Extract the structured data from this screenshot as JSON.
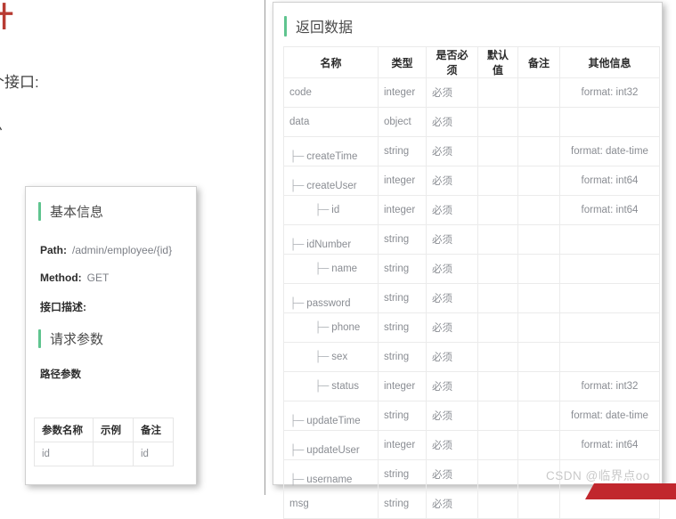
{
  "document_fragments": {
    "heading": "计",
    "line1": "个接口:",
    "line2": "息"
  },
  "basic_info_card": {
    "title": "基本信息",
    "fields": [
      {
        "key": "Path:",
        "value": "/admin/employee/{id}"
      },
      {
        "key": "Method:",
        "value": "GET"
      },
      {
        "key": "接口描述:",
        "value": ""
      }
    ],
    "params_title": "请求参数",
    "path_param_label": "路径参数",
    "param_table": {
      "headers": [
        "参数名称",
        "示例",
        "备注"
      ],
      "rows": [
        {
          "name": "id",
          "demo": "",
          "note": "id"
        }
      ]
    }
  },
  "return_data_card": {
    "title": "返回数据",
    "table": {
      "headers": [
        "名称",
        "类型",
        "是否必须",
        "默认值",
        "备注",
        "其他信息"
      ],
      "rows": [
        {
          "name": "code",
          "indent": 0,
          "type": "integer",
          "required": "必须",
          "default": "",
          "remark": "",
          "extra": "format: int32"
        },
        {
          "name": "data",
          "indent": 0,
          "type": "object",
          "required": "必须",
          "default": "",
          "remark": "",
          "extra": ""
        },
        {
          "name": "createTime",
          "indent": 1,
          "type": "string",
          "required": "必须",
          "default": "",
          "remark": "",
          "extra": "format: date-time"
        },
        {
          "name": "createUser",
          "indent": 1,
          "type": "integer",
          "required": "必须",
          "default": "",
          "remark": "",
          "extra": "format: int64"
        },
        {
          "name": "id",
          "indent": 1,
          "type": "integer",
          "required": "必须",
          "default": "",
          "remark": "",
          "extra": "format: int64"
        },
        {
          "name": "idNumber",
          "indent": 1,
          "type": "string",
          "required": "必须",
          "default": "",
          "remark": "",
          "extra": ""
        },
        {
          "name": "name",
          "indent": 1,
          "type": "string",
          "required": "必须",
          "default": "",
          "remark": "",
          "extra": ""
        },
        {
          "name": "password",
          "indent": 1,
          "type": "string",
          "required": "必须",
          "default": "",
          "remark": "",
          "extra": ""
        },
        {
          "name": "phone",
          "indent": 1,
          "type": "string",
          "required": "必须",
          "default": "",
          "remark": "",
          "extra": ""
        },
        {
          "name": "sex",
          "indent": 1,
          "type": "string",
          "required": "必须",
          "default": "",
          "remark": "",
          "extra": ""
        },
        {
          "name": "status",
          "indent": 1,
          "type": "integer",
          "required": "必须",
          "default": "",
          "remark": "",
          "extra": "format: int32"
        },
        {
          "name": "updateTime",
          "indent": 1,
          "type": "string",
          "required": "必须",
          "default": "",
          "remark": "",
          "extra": "format: date-time"
        },
        {
          "name": "updateUser",
          "indent": 1,
          "type": "integer",
          "required": "必须",
          "default": "",
          "remark": "",
          "extra": "format: int64"
        },
        {
          "name": "username",
          "indent": 1,
          "type": "string",
          "required": "必须",
          "default": "",
          "remark": "",
          "extra": ""
        },
        {
          "name": "msg",
          "indent": 0,
          "type": "string",
          "required": "必须",
          "default": "",
          "remark": "",
          "extra": ""
        }
      ]
    }
  },
  "watermark": "CSDN @临界点oo",
  "ribbon": {
    "text": ""
  },
  "colors": {
    "accent_green": "#5fc48f",
    "heading_red": "#b83b32",
    "ribbon_red": "#c1272d",
    "table_border": "#ebebeb",
    "muted_text": "#8a8d93"
  },
  "tree_branch_glyph": "├─"
}
